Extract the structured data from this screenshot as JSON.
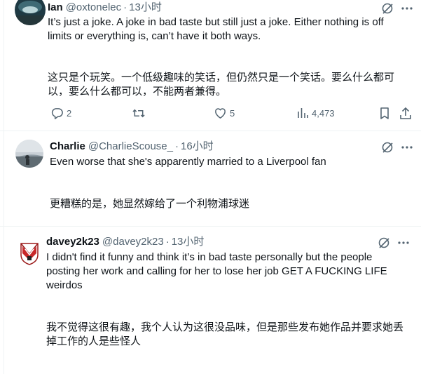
{
  "tweets": [
    {
      "display_name": "Ian",
      "handle": "@oxtonelec",
      "time": "13小时",
      "text_en": "It’s just a joke. A joke in bad taste but still just a joke. Either nothing is off limits or everything is, can’t have it both ways.",
      "text_zh": "这只是个玩笑。一个低级趣味的笑话，但仍然只是一个笑话。要么什么都可以，要么什么都可以，不能两者兼得。",
      "actions": {
        "replies": "2",
        "likes": "5",
        "views": "4,473"
      },
      "icons": [
        "reply-icon",
        "retweet-icon",
        "like-icon",
        "views-icon",
        "bookmark-icon",
        "share-icon"
      ]
    },
    {
      "display_name": "Charlie",
      "handle": "@CharlieScouse_",
      "time": "16小时",
      "text_en": "Even worse that she's apparently married to a Liverpool fan",
      "text_zh": "更糟糕的是，她显然嫁给了一个利物浦球迷"
    },
    {
      "display_name": "davey2k23",
      "handle": "@davey2k23",
      "time": "13小时",
      "text_en": "I didn't find it funny and think it’s in bad taste personally but the people posting her work and calling for her to lose her job GET A FUCKING LIFE weirdos",
      "text_zh": "我不觉得这很有趣，我个人认为这很没品味，但是那些发布她作品并要求她丢掉工作的人是些怪人"
    }
  ],
  "colors": {
    "text_primary": "#0f1419",
    "text_secondary": "#536471",
    "divider": "#eff3f4",
    "background": "#ffffff"
  }
}
